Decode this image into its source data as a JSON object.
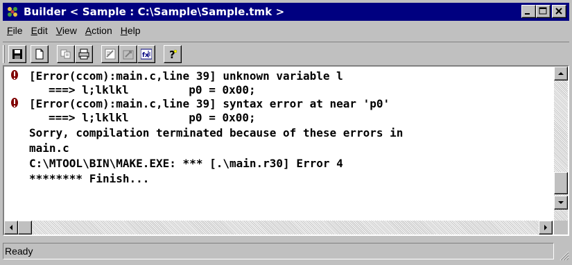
{
  "window": {
    "title": "Builder < Sample : C:\\Sample\\Sample.tmk >"
  },
  "menu": {
    "items": [
      {
        "label": "File",
        "mnemonic": "F",
        "rest": "ile"
      },
      {
        "label": "Edit",
        "mnemonic": "E",
        "rest": "dit"
      },
      {
        "label": "View",
        "mnemonic": "V",
        "rest": "iew"
      },
      {
        "label": "Action",
        "mnemonic": "A",
        "rest": "ction"
      },
      {
        "label": "Help",
        "mnemonic": "H",
        "rest": "elp"
      }
    ]
  },
  "toolbar": {
    "icons": [
      "save-icon",
      "new-file-icon",
      "copy-icon",
      "print-icon",
      "edit-icon",
      "build-icon",
      "function-icon",
      "help-icon"
    ]
  },
  "output": {
    "lines": [
      {
        "type": "error",
        "text": "[Error(ccom):main.c,line 39] unknown variable l"
      },
      {
        "type": "indent",
        "text": "===> l;lklkl         p0 = 0x00;"
      },
      {
        "type": "error",
        "text": "[Error(ccom):main.c,line 39] syntax error at near 'p0'"
      },
      {
        "type": "indent",
        "text": "===> l;lklkl         p0 = 0x00;"
      },
      {
        "type": "plain",
        "text": "Sorry, compilation terminated because of these errors in"
      },
      {
        "type": "plain",
        "text": "main.c"
      },
      {
        "type": "plain",
        "text": "C:\\MTOOL\\BIN\\MAKE.EXE: *** [.\\main.r30] Error 4"
      },
      {
        "type": "plain",
        "text": "******** Finish..."
      }
    ]
  },
  "status": {
    "text": "Ready"
  },
  "colors": {
    "titlebar": "#000080",
    "error_icon": "#800000"
  }
}
